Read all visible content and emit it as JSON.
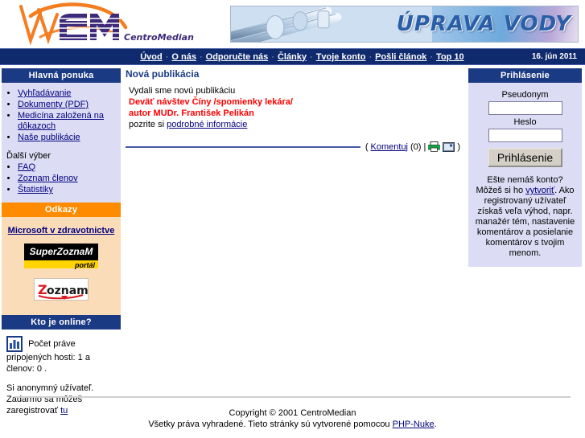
{
  "header": {
    "logo_text": "CM",
    "logo_sub": "CentroMedian",
    "banner_text": "ÚPRAVA VODY"
  },
  "nav": {
    "items": [
      {
        "label": "Úvod"
      },
      {
        "label": "O nás"
      },
      {
        "label": "Odporučte nás"
      },
      {
        "label": "Články"
      },
      {
        "label": "Tvoje konto"
      },
      {
        "label": "Pošli článok"
      },
      {
        "label": "Top 10"
      }
    ],
    "separator": "·",
    "date": "16. jún 2011"
  },
  "sidebar": {
    "main_menu": {
      "title": "Hlavná ponuka",
      "items": [
        {
          "label": "Vyhľadávanie"
        },
        {
          "label": "Dokumenty (PDF)"
        },
        {
          "label": "Medicína založená na dôkazoch"
        },
        {
          "label": "Naše publikácie"
        }
      ],
      "subtitle": "Ďalší výber",
      "sub_items": [
        {
          "label": "FAQ"
        },
        {
          "label": "Zoznam členov"
        },
        {
          "label": "Štatistiky"
        }
      ]
    },
    "links": {
      "title": "Odkazy",
      "ms_link": "Microsoft v zdravotnictve",
      "superzoznam": {
        "name": "SuperZoznaM",
        "tag": "portál"
      },
      "zoznam": {
        "name": "Zoznam"
      }
    },
    "online": {
      "title": "Kto je online?",
      "line1": "Počet práve pripojených hosti: 1 a členov: 0 .",
      "line2_a": "Si anonymný užívateľ. Zadarmo sa môžeš zaregistrovať ",
      "line2_link": "tu"
    }
  },
  "main": {
    "story_title": "Nová publikácia",
    "intro": "Vydali sme novú publikáciu",
    "red_line1": "Deväť návštev Číny /spomienky lekára/",
    "red_line2": "autor MUDr. František Pelikán",
    "read_prefix": "pozrite si ",
    "read_link": "podrobné informácie",
    "comment_open": "( ",
    "comment_link": "Komentuj",
    "comment_count": "(0)",
    "comment_pipe": "|",
    "comment_close": ")",
    "print_icon": "printer-icon",
    "mail_icon": "mail-icon"
  },
  "login": {
    "title": "Prihlásenie",
    "user_label": "Pseudonym",
    "user_value": "",
    "user_placeholder": "",
    "pass_label": "Heslo",
    "pass_value": "",
    "pass_placeholder": "",
    "submit_label": "Prihlásenie",
    "note_a": "Ešte nemáš konto? Môžeš si ho ",
    "note_link": "vytvoriť",
    "note_b": ". Ako registrovaný užívateľ získaš veľa výhod, napr. manažér tém, nastavenie komentárov a posielanie komentárov s tvojim menom."
  },
  "footer": {
    "copyright": "Copyright © 2001 CentroMedian",
    "rights_a": "Všetky práva vyhradené. Tieto stránky sú vytvorené pomocou ",
    "rights_link": "PHP-Nuke",
    "rights_b": "."
  },
  "colors": {
    "nav_bar": "#102a6e",
    "block_header": "#1b3a84",
    "block_header_orange": "#ff8c00",
    "sidebar_bg": "#dcdcf4",
    "links_bg": "#fbdcb8",
    "link_text": "#000080",
    "accent_red": "#ff0000",
    "logo_orange": "#f57c1f",
    "logo_purple": "#3d2a7a"
  }
}
